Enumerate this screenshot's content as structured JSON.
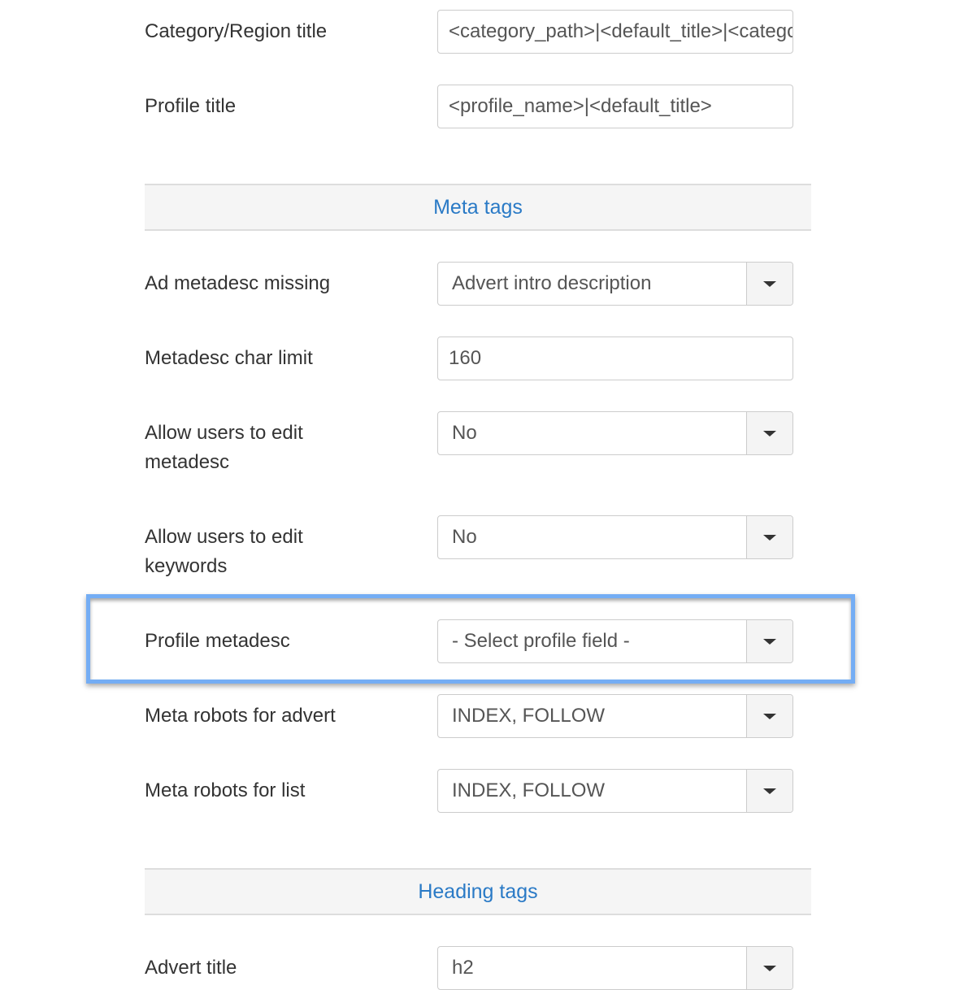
{
  "fields": {
    "category_region_title": {
      "label": "Category/Region title",
      "value": "<category_path>|<default_title>|<category_path>"
    },
    "profile_title": {
      "label": "Profile title",
      "value": "<profile_name>|<default_title>"
    },
    "ad_metadesc_missing": {
      "label": "Ad metadesc missing",
      "value": "Advert intro description"
    },
    "metadesc_char_limit": {
      "label": "Metadesc char limit",
      "value": "160"
    },
    "allow_edit_metadesc": {
      "label_line1": "Allow users to edit",
      "label_line2": "metadesc",
      "value": "No"
    },
    "allow_edit_keywords": {
      "label_line1": "Allow users to edit",
      "label_line2": "keywords",
      "value": "No"
    },
    "profile_metadesc": {
      "label": "Profile metadesc",
      "value": "- Select profile field -"
    },
    "meta_robots_advert": {
      "label": "Meta robots for advert",
      "value": "INDEX, FOLLOW"
    },
    "meta_robots_list": {
      "label": "Meta robots for list",
      "value": "INDEX, FOLLOW"
    },
    "advert_title": {
      "label": "Advert title",
      "value": "h2"
    }
  },
  "sections": {
    "meta_tags": "Meta tags",
    "heading_tags": "Heading tags"
  },
  "icons": {
    "dropdown": "caret-down-icon"
  },
  "colors": {
    "section_link": "#2a7ac6",
    "highlight_border": "#74adf4"
  }
}
